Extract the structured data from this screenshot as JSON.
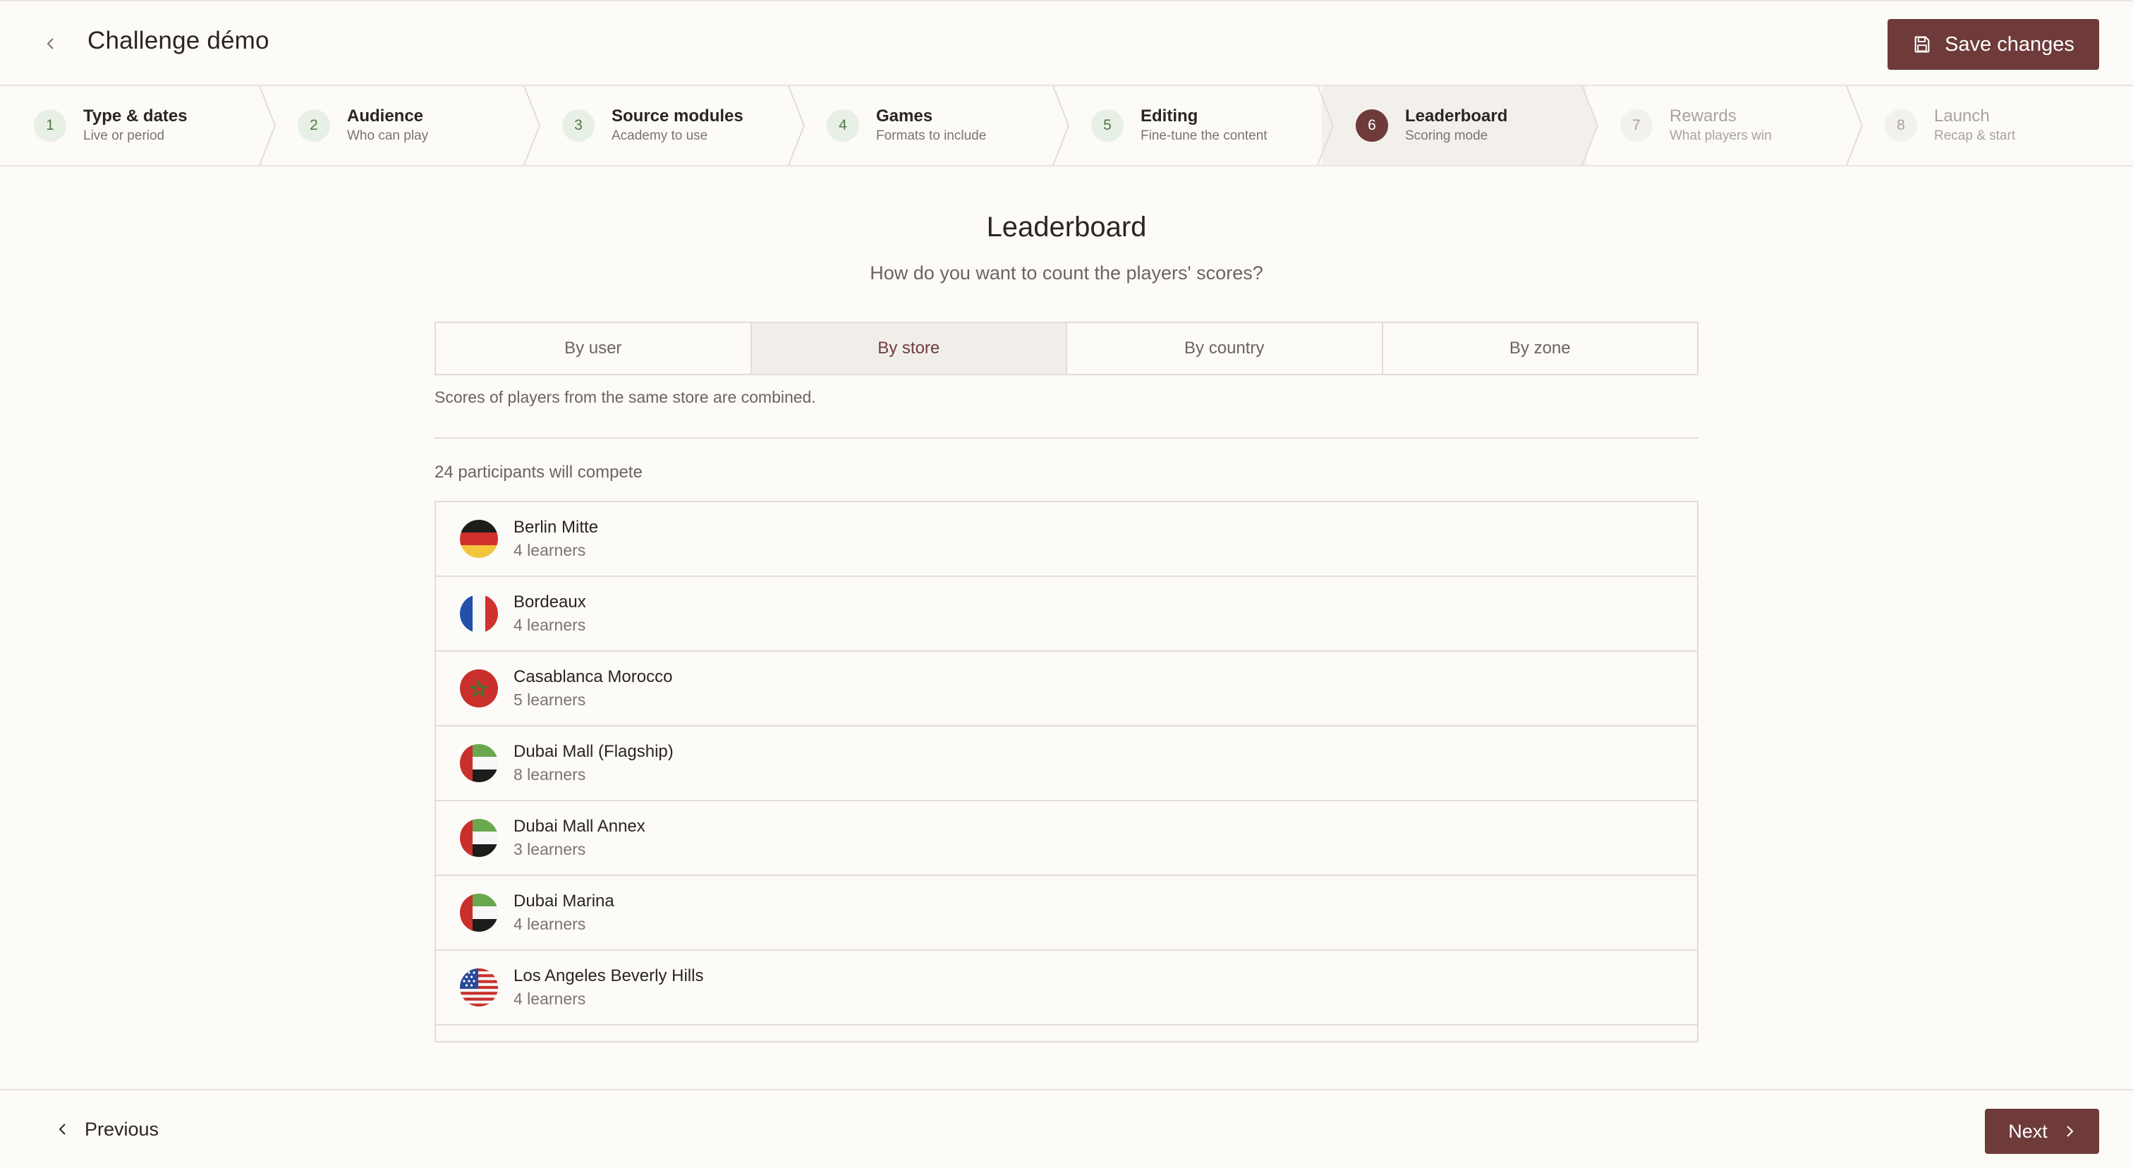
{
  "header": {
    "title": "Challenge démo",
    "save_label": "Save changes"
  },
  "steps": [
    {
      "num": "1",
      "title": "Type & dates",
      "sub": "Live or period",
      "state": "done"
    },
    {
      "num": "2",
      "title": "Audience",
      "sub": "Who can play",
      "state": "done"
    },
    {
      "num": "3",
      "title": "Source modules",
      "sub": "Academy to use",
      "state": "done"
    },
    {
      "num": "4",
      "title": "Games",
      "sub": "Formats to include",
      "state": "done"
    },
    {
      "num": "5",
      "title": "Editing",
      "sub": "Fine-tune the content",
      "state": "done"
    },
    {
      "num": "6",
      "title": "Leaderboard",
      "sub": "Scoring mode",
      "state": "active"
    },
    {
      "num": "7",
      "title": "Rewards",
      "sub": "What players win",
      "state": "todo"
    },
    {
      "num": "8",
      "title": "Launch",
      "sub": "Recap & start",
      "state": "todo"
    }
  ],
  "main": {
    "title": "Leaderboard",
    "subtitle": "How do you want to count the players' scores?",
    "options": [
      "By user",
      "By store",
      "By country",
      "By zone"
    ],
    "selected_option": "By store",
    "option_note": "Scores of players from the same store are combined.",
    "participants_text": "24 participants will compete",
    "stores": [
      {
        "name": "Berlin Mitte",
        "learners": "4 learners",
        "flag": "de"
      },
      {
        "name": "Bordeaux",
        "learners": "4 learners",
        "flag": "fr"
      },
      {
        "name": "Casablanca Morocco",
        "learners": "5 learners",
        "flag": "ma"
      },
      {
        "name": "Dubai Mall (Flagship)",
        "learners": "8 learners",
        "flag": "ae"
      },
      {
        "name": "Dubai Mall Annex",
        "learners": "3 learners",
        "flag": "ae"
      },
      {
        "name": "Dubai Marina",
        "learners": "4 learners",
        "flag": "ae"
      },
      {
        "name": "Los Angeles Beverly Hills",
        "learners": "4 learners",
        "flag": "us"
      }
    ]
  },
  "footer": {
    "previous_label": "Previous",
    "next_label": "Next"
  },
  "colors": {
    "accent": "#6e3b3a",
    "done_step_bg": "#e8f0e5",
    "done_step_text": "#4f7a45",
    "background": "#fcfbf8"
  }
}
